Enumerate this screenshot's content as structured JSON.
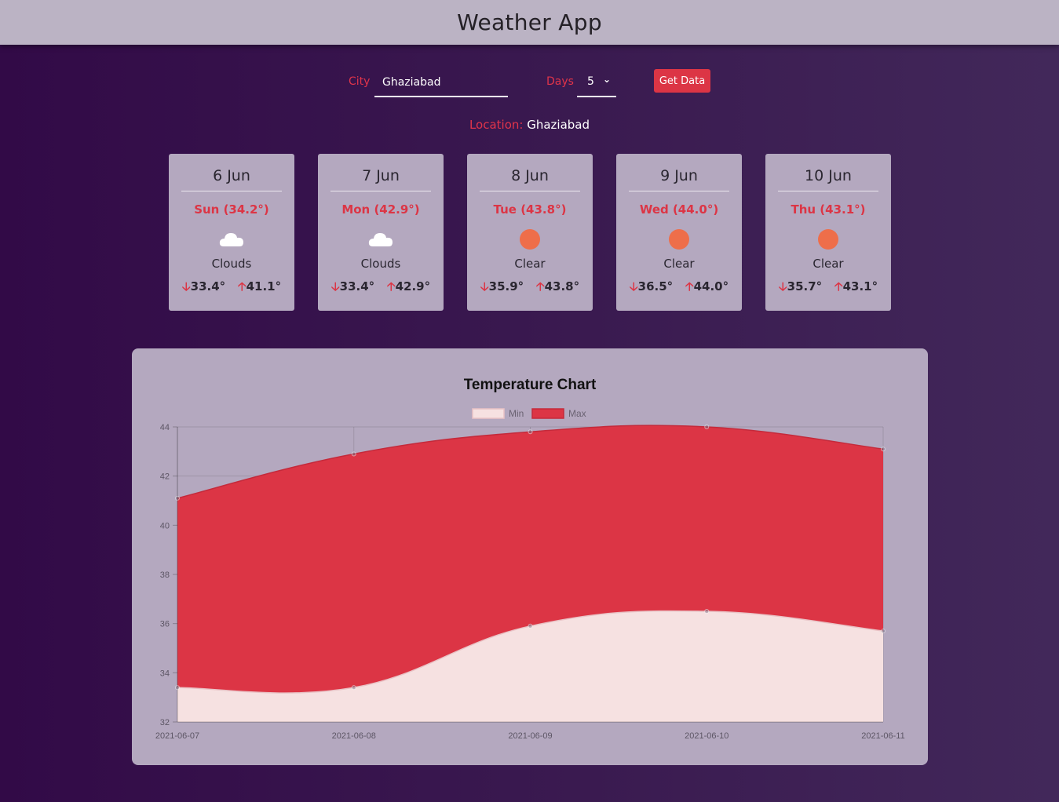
{
  "app": {
    "title": "Weather App"
  },
  "form": {
    "city_label": "City",
    "city_value": "Ghaziabad",
    "days_label": "Days",
    "days_value": "5",
    "submit_label": "Get Data"
  },
  "location": {
    "label": "Location:",
    "value": "Ghaziabad"
  },
  "cards": [
    {
      "date": "6 Jun",
      "day": "Sun (34.2°)",
      "icon": "cloud-icon",
      "condition": "Clouds",
      "min": "33.4°",
      "max": "41.1°"
    },
    {
      "date": "7 Jun",
      "day": "Mon (42.9°)",
      "icon": "cloud-icon",
      "condition": "Clouds",
      "min": "33.4°",
      "max": "42.9°"
    },
    {
      "date": "8 Jun",
      "day": "Tue (43.8°)",
      "icon": "sun-icon",
      "condition": "Clear",
      "min": "35.9°",
      "max": "43.8°"
    },
    {
      "date": "9 Jun",
      "day": "Wed (44.0°)",
      "icon": "sun-icon",
      "condition": "Clear",
      "min": "36.5°",
      "max": "44.0°"
    },
    {
      "date": "10 Jun",
      "day": "Thu (43.1°)",
      "icon": "sun-icon",
      "condition": "Clear",
      "min": "35.7°",
      "max": "43.1°"
    }
  ],
  "arrows": {
    "down": "🡣",
    "up": "🡡"
  },
  "colors": {
    "accent": "#dc3545",
    "min_fill": "#f6e1e1",
    "max_fill": "#dc3545",
    "sun": "#ee6e4a",
    "card_bg": "#b4a8bf"
  },
  "chart_data": {
    "type": "area",
    "title": "Temperature Chart",
    "x": [
      "2021-06-07",
      "2021-06-08",
      "2021-06-09",
      "2021-06-10",
      "2021-06-11"
    ],
    "series": [
      {
        "name": "Min",
        "values": [
          33.4,
          33.4,
          35.9,
          36.5,
          35.7
        ]
      },
      {
        "name": "Max",
        "values": [
          41.1,
          42.9,
          43.8,
          44.0,
          43.1
        ]
      }
    ],
    "yticks": [
      "32",
      "34",
      "36",
      "38",
      "40",
      "42",
      "44"
    ],
    "ylim": [
      32,
      44
    ],
    "legend": "top",
    "grid": true
  }
}
